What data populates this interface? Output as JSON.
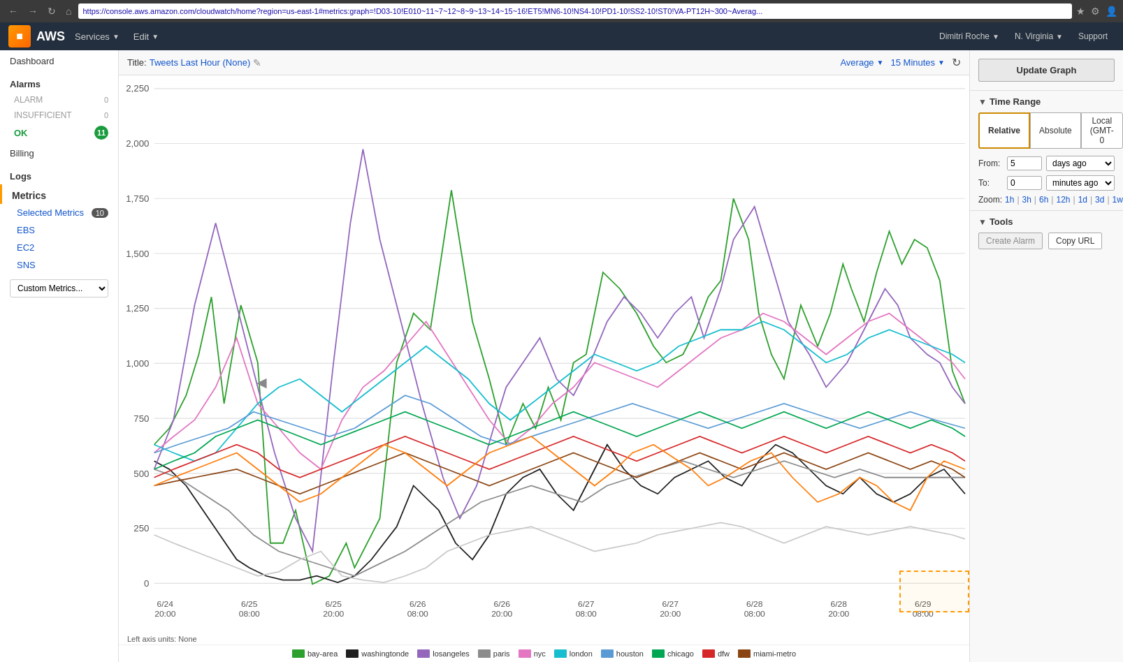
{
  "browser": {
    "url": "https://console.aws.amazon.com/cloudwatch/home?region=us-east-1#metrics:graph=!D03-10!E010~11~7~12~8~9~13~14~15~16!ET5!MN6-10!NS4-10!PD1-10!SS2-10!ST0!VA-PT12H~300~Averag...",
    "nav_back": "←",
    "nav_forward": "→",
    "nav_refresh": "↻"
  },
  "aws_nav": {
    "brand": "AWS",
    "menu_items": [
      "Services",
      "Edit"
    ],
    "user": "Dimitri Roche",
    "region": "N. Virginia",
    "support": "Support"
  },
  "sidebar": {
    "dashboard_label": "Dashboard",
    "alarms_label": "Alarms",
    "alarm_label": "ALARM",
    "alarm_count": "0",
    "insufficient_label": "INSUFFICIENT",
    "insufficient_count": "0",
    "ok_label": "OK",
    "ok_count": "11",
    "billing_label": "Billing",
    "logs_label": "Logs",
    "metrics_label": "Metrics",
    "selected_metrics_label": "Selected Metrics",
    "selected_metrics_count": "10",
    "ebs_label": "EBS",
    "ec2_label": "EC2",
    "sns_label": "SNS",
    "custom_metrics_label": "Custom Metrics..."
  },
  "chart": {
    "title_prefix": "Title:",
    "title_value": "Tweets Last Hour (None)",
    "stat_label": "Average",
    "period_label": "15 Minutes",
    "y_axis": [
      2250,
      2000,
      1750,
      1500,
      1250,
      1000,
      750,
      500,
      250,
      0
    ],
    "x_axis": [
      "6/24\n20:00",
      "6/25\n08:00",
      "6/25\n20:00",
      "6/26\n08:00",
      "6/26\n20:00",
      "6/27\n08:00",
      "6/27\n20:00",
      "6/28\n08:00",
      "6/28\n20:00",
      "6/29\n08:00"
    ],
    "axis_label": "Left axis units: None",
    "legend": [
      {
        "color": "#2ca02c",
        "label": "bay-area"
      },
      {
        "color": "#1f1f1f",
        "label": "washingtonde"
      },
      {
        "color": "#9467bd",
        "label": "losangeles"
      },
      {
        "color": "#8c8c8c",
        "label": "paris"
      },
      {
        "color": "#e377c2",
        "label": "nyc"
      },
      {
        "color": "#17becf",
        "label": "london"
      },
      {
        "color": "#5b9bd5",
        "label": "houston"
      },
      {
        "color": "#00a651",
        "label": "chicago"
      },
      {
        "color": "#d62728",
        "label": "dfw"
      },
      {
        "color": "#8B4513",
        "label": "miami-metro"
      }
    ]
  },
  "right_panel": {
    "update_graph_btn": "Update Graph",
    "time_range_label": "Time Range",
    "relative_tab": "Relative",
    "absolute_tab": "Absolute",
    "local_tab": "Local (GMT-0",
    "from_label": "From:",
    "from_value": "5",
    "from_unit": "days ago",
    "to_label": "To:",
    "to_value": "0",
    "to_unit": "minutes ago",
    "zoom_label": "Zoom:",
    "zoom_options": [
      "1h",
      "3h",
      "6h",
      "12h",
      "1d",
      "3d",
      "1w"
    ],
    "tools_label": "Tools",
    "create_alarm_btn": "Create Alarm",
    "copy_url_btn": "Copy URL"
  }
}
